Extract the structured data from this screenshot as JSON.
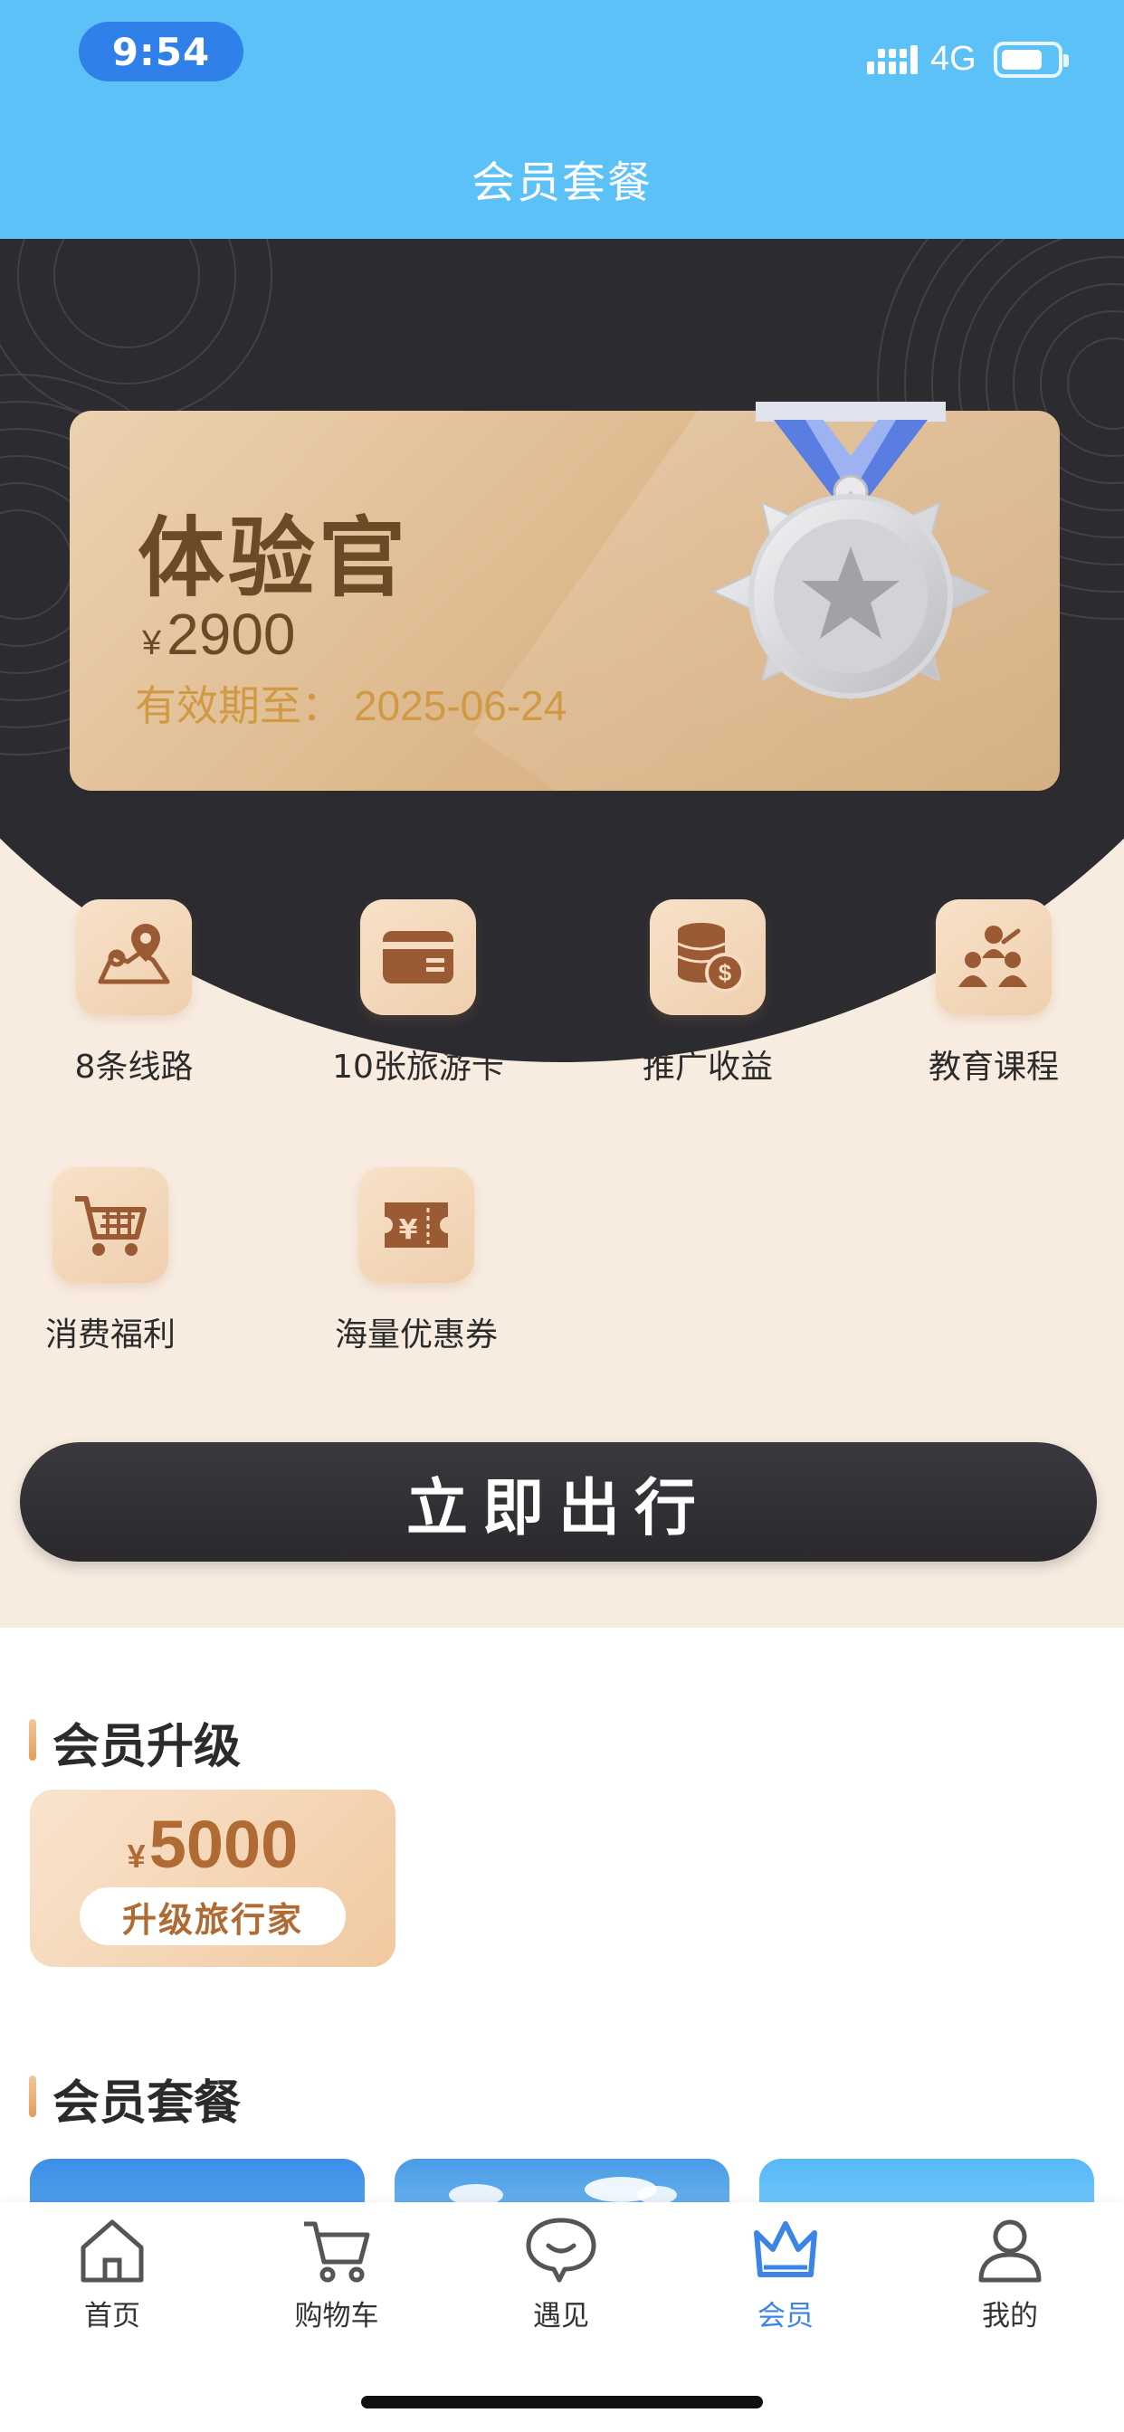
{
  "status_bar": {
    "time": "9:54",
    "network": "4G"
  },
  "header": {
    "title": "会员套餐"
  },
  "member_card": {
    "title": "体验官",
    "currency": "¥",
    "price": "2900",
    "valid_label": "有效期至：",
    "valid_date": "2025-06-24"
  },
  "benefits": [
    {
      "label": "8条线路",
      "icon": "map-route-icon"
    },
    {
      "label": "10张旅游卡",
      "icon": "travel-card-icon"
    },
    {
      "label": "推广收益",
      "icon": "coins-income-icon"
    },
    {
      "label": "教育课程",
      "icon": "education-class-icon"
    },
    {
      "label": "消费福利",
      "icon": "shopping-cart-icon"
    },
    {
      "label": "海量优惠券",
      "icon": "coupon-ticket-icon"
    }
  ],
  "cta": {
    "label": "立即出行"
  },
  "upgrade": {
    "section_title": "会员升级",
    "currency": "¥",
    "price": "5000",
    "button_label": "升级旅行家"
  },
  "packages": {
    "section_title": "会员套餐"
  },
  "tabbar": {
    "active": "会员",
    "items": [
      {
        "label": "首页",
        "icon": "home-icon"
      },
      {
        "label": "购物车",
        "icon": "cart-icon"
      },
      {
        "label": "遇见",
        "icon": "chat-bubble-icon"
      },
      {
        "label": "会员",
        "icon": "crown-icon"
      },
      {
        "label": "我的",
        "icon": "user-icon"
      }
    ]
  },
  "colors": {
    "header_blue": "#5cc1f7",
    "time_pill": "#2f80e8",
    "card_gold": "#dcb68a",
    "accent_brown": "#6b4a25",
    "valid_gold": "#cf9a43",
    "active_tab": "#3c84e6",
    "dark_bg": "#2c2b30"
  }
}
